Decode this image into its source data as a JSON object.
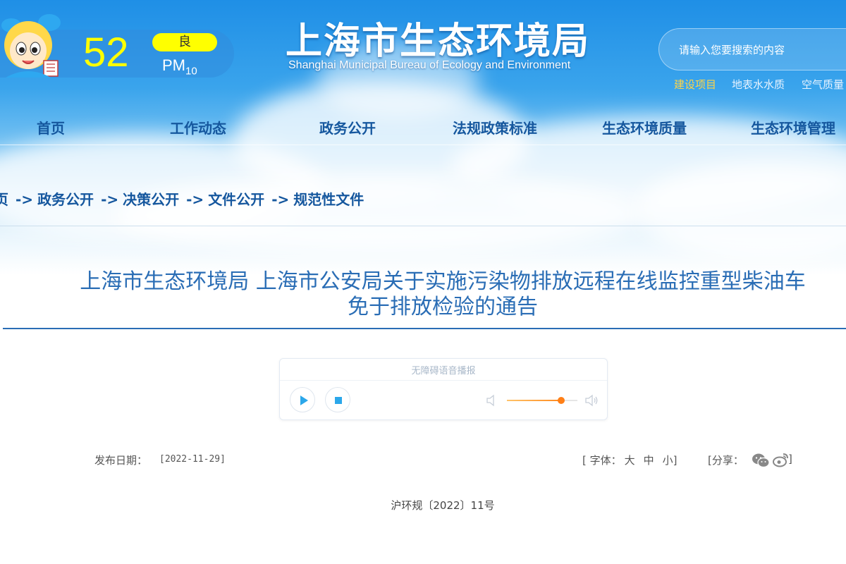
{
  "aqi": {
    "value": "52",
    "level": "良",
    "pollutant": "PM",
    "pollutant_sub": "10",
    "level_color": "#ffff00"
  },
  "header": {
    "title": "上海市生态环境局",
    "subtitle": "Shanghai Municipal Bureau of Ecology and Environment",
    "search_placeholder": "请输入您要搜索的内容",
    "quick_links": [
      "建设项目",
      "地表水水质",
      "空气质量"
    ]
  },
  "nav": {
    "items": [
      "首页",
      "工作动态",
      "政务公开",
      "法规政策标准",
      "生态环境质量",
      "生态环境管理"
    ]
  },
  "breadcrumb": {
    "items": [
      "页",
      "政务公开",
      "决策公开",
      "文件公开",
      "规范性文件"
    ],
    "separator": "->"
  },
  "article": {
    "title_line1": "上海市生态环境局 上海市公安局关于实施污染物排放远程在线监控重型柴油车",
    "title_line2": "免于排放检验的通告",
    "doc_number": "沪环规〔2022〕11号"
  },
  "player": {
    "label": "无障碍语音播报",
    "volume": 0.77,
    "accent_color": "#ff7f16"
  },
  "meta": {
    "date_label": "发布日期：",
    "date_value": "[2022-11-29]",
    "font_label": "[ 字体：",
    "font_large": "大",
    "font_medium": "中",
    "font_small": "小]",
    "share_label": "[分享：",
    "share_end": "]"
  },
  "colors": {
    "brand_blue": "#15579e",
    "title_blue": "#2a6db5",
    "sky_top": "#1f8fe6"
  }
}
